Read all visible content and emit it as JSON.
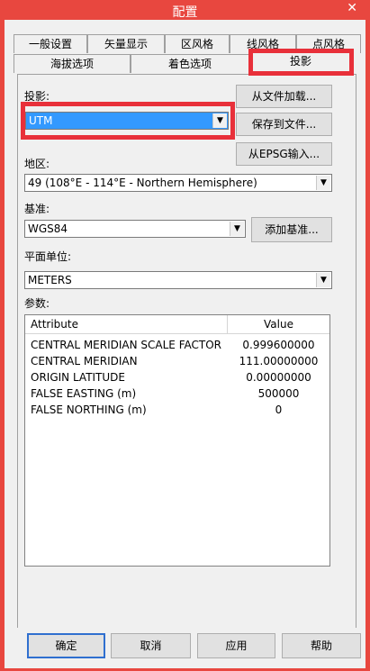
{
  "window": {
    "title": "配置",
    "close_glyph": "✕"
  },
  "tabs_row1": [
    "一般设置",
    "矢量显示",
    "区风格",
    "线风格",
    "点风格"
  ],
  "tabs_row2": [
    "海拔选项",
    "着色选项",
    "投影"
  ],
  "projection": {
    "label": "投影:",
    "selected": "UTM",
    "load_button": "从文件加载...",
    "save_button": "保存到文件...",
    "epsg_button": "从EPSG输入..."
  },
  "zone": {
    "label": "地区:",
    "selected": "49 (108°E - 114°E - Northern Hemisphere)"
  },
  "datum": {
    "label": "基准:",
    "selected": "WGS84",
    "add_button": "添加基准..."
  },
  "units": {
    "label": "平面单位:",
    "selected": "METERS"
  },
  "params": {
    "label": "参数:",
    "columns": [
      "Attribute",
      "Value"
    ],
    "rows": [
      [
        "CENTRAL MERIDIAN SCALE FACTOR",
        "0.999600000"
      ],
      [
        "CENTRAL MERIDIAN",
        "111.00000000"
      ],
      [
        "ORIGIN LATITUDE",
        "0.00000000"
      ],
      [
        "FALSE EASTING (m)",
        "500000"
      ],
      [
        "FALSE NORTHING (m)",
        "0"
      ]
    ]
  },
  "footer": {
    "ok": "确定",
    "cancel": "取消",
    "apply": "应用",
    "help": "帮助"
  },
  "icons": {
    "dropdown": "▼"
  },
  "colors": {
    "titlebar": "#e8473f",
    "highlight": "#e8303a",
    "selection": "#3399ff"
  }
}
